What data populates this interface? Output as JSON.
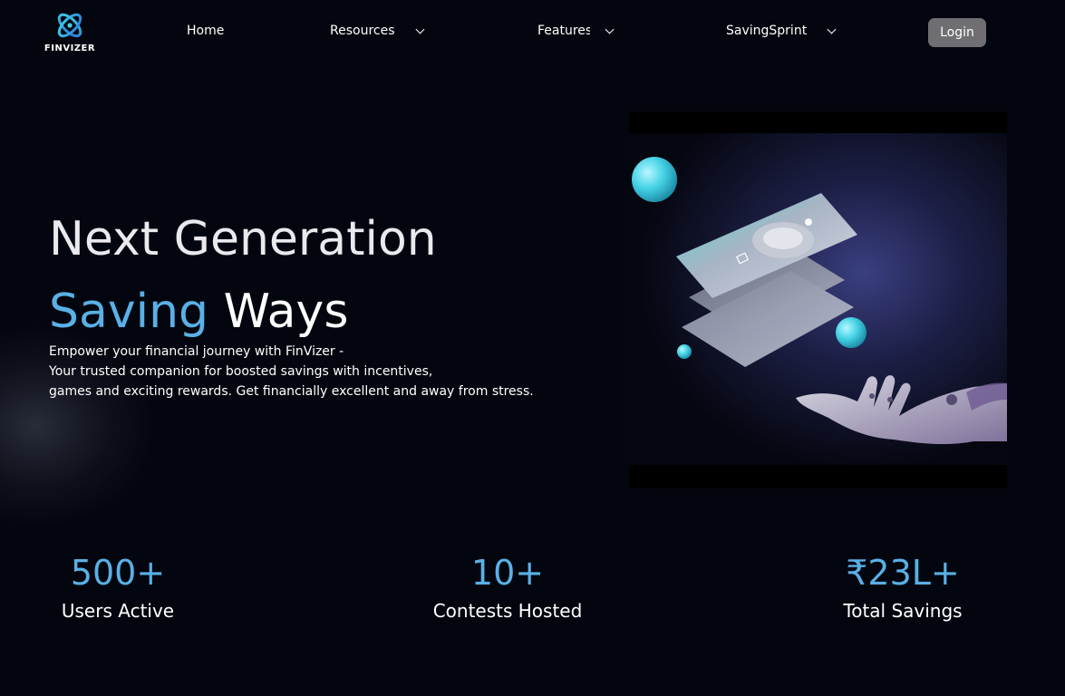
{
  "nav": {
    "logo_text": "FINVIZER",
    "home": "Home",
    "resources": "Resources",
    "features": "Features",
    "saving_sprint": "SavingSprint",
    "login": "Login"
  },
  "hero": {
    "title_line1": "Next Generation",
    "title_accent": "Saving",
    "title_rest": "Ways",
    "description": [
      "Empower your financial journey with FinVizer -",
      "Your trusted companion for boosted savings with incentives,",
      "games and exciting rewards. Get financially excellent and away from stress."
    ]
  },
  "stats": [
    {
      "value": "500+",
      "label": "Users Active"
    },
    {
      "value": "10+",
      "label": "Contests Hosted"
    },
    {
      "value": "₹23L+",
      "label": "Total Savings"
    }
  ],
  "colors": {
    "background": "#04060f",
    "accent": "#5ab0e6",
    "login_button": "#6f6f73"
  },
  "icons": {
    "logo": "atom-logo-icon",
    "dropdown": "chevron-down-icon"
  }
}
